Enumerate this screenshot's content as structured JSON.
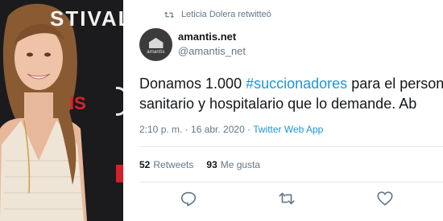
{
  "photo": {
    "bg_text": "STIVAL",
    "red_text": "IS"
  },
  "retweet": {
    "text": "Leticia Dolera retwitteó",
    "icon": "retweet-icon"
  },
  "author": {
    "name": "amantis.net",
    "handle": "@amantis_net",
    "avatar_text": "amantis"
  },
  "tweet": {
    "text_before": "Donamos 1.000 ",
    "hashtag": "#succionadores",
    "text_after": " para  el personal",
    "line2": "sanitario y hospitalario que lo demande.  Ab"
  },
  "meta": {
    "time_date": "2:10 p. m. · 16 abr. 2020 · ",
    "app": "Twitter Web App"
  },
  "stats": {
    "retweets_count": "52",
    "retweets_label": "Retweets",
    "likes_count": "93",
    "likes_label": "Me gusta"
  },
  "actions": [
    {
      "icon": "reply-icon"
    },
    {
      "icon": "retweet-icon"
    },
    {
      "icon": "like-icon"
    }
  ],
  "colors": {
    "link": "#1b95e0",
    "muted": "#657786",
    "text": "#14171a",
    "divider": "#e1e8ed"
  }
}
